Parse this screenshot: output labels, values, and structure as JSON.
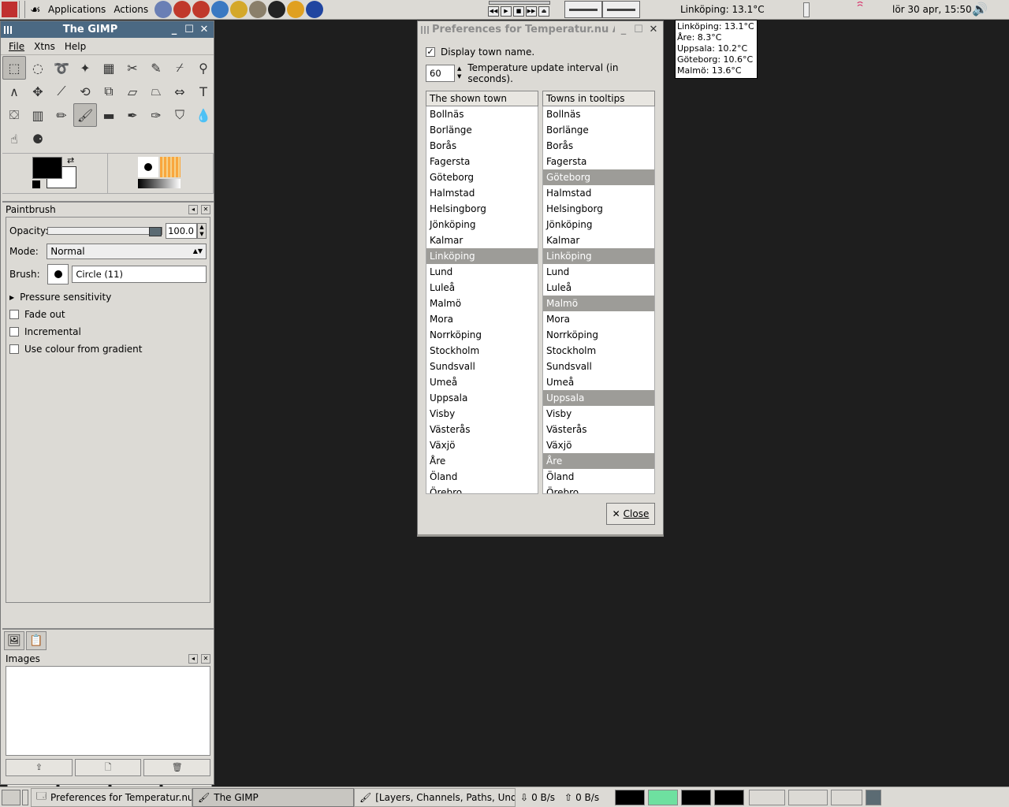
{
  "top_panel": {
    "menus": [
      "Applications",
      "Actions"
    ],
    "launchers": [
      {
        "icon": "image-viewer-icon",
        "color": "#6a7fb5"
      },
      {
        "icon": "alarm-clock-icon",
        "color": "#c0392b"
      },
      {
        "icon": "alarm-clock-icon",
        "color": "#c0392b"
      },
      {
        "icon": "web-browser-icon",
        "color": "#3a79c2"
      },
      {
        "icon": "compass-icon",
        "color": "#d4a82a"
      },
      {
        "icon": "gimp-icon",
        "color": "#8a7f6a"
      },
      {
        "icon": "football-icon",
        "color": "#222222"
      },
      {
        "icon": "person-icon",
        "color": "#e0a020"
      },
      {
        "icon": "bird-icon",
        "color": "#2045a0"
      }
    ],
    "temperature": "Linköping: 13.1°C",
    "clock": "lör 30 apr, 15:50"
  },
  "tooltip": {
    "lines": [
      "Linköping: 13.1°C",
      "Åre: 8.3°C",
      "Uppsala: 10.2°C",
      "Göteborg: 10.6°C",
      "Malmö: 13.6°C"
    ]
  },
  "gimp": {
    "title": "The GIMP",
    "menu": [
      "File",
      "Xtns",
      "Help"
    ],
    "tools": [
      {
        "name": "rect-select-icon",
        "glyph": "⬚",
        "active": true
      },
      {
        "name": "ellipse-select-icon",
        "glyph": "◌"
      },
      {
        "name": "lasso-icon",
        "glyph": "➰"
      },
      {
        "name": "fuzzy-select-icon",
        "glyph": "✦"
      },
      {
        "name": "color-select-icon",
        "glyph": "▦"
      },
      {
        "name": "scissors-icon",
        "glyph": "✂"
      },
      {
        "name": "paths-icon",
        "glyph": "✎"
      },
      {
        "name": "color-picker-icon",
        "glyph": "⌿"
      },
      {
        "name": "zoom-icon",
        "glyph": "⚲"
      },
      {
        "name": "measure-icon",
        "glyph": "∧"
      },
      {
        "name": "move-icon",
        "glyph": "✥"
      },
      {
        "name": "crop-icon",
        "glyph": "⟋"
      },
      {
        "name": "rotate-icon",
        "glyph": "⟲"
      },
      {
        "name": "scale-icon",
        "glyph": "⧉"
      },
      {
        "name": "shear-icon",
        "glyph": "▱"
      },
      {
        "name": "perspective-icon",
        "glyph": "⏢"
      },
      {
        "name": "flip-icon",
        "glyph": "⇔"
      },
      {
        "name": "text-icon",
        "glyph": "T"
      },
      {
        "name": "bucket-fill-icon",
        "glyph": "⛋"
      },
      {
        "name": "gradient-icon",
        "glyph": "▥"
      },
      {
        "name": "pencil-icon",
        "glyph": "✏"
      },
      {
        "name": "paintbrush-icon",
        "glyph": "🖌",
        "active": true
      },
      {
        "name": "eraser-icon",
        "glyph": "▬"
      },
      {
        "name": "airbrush-icon",
        "glyph": "✒"
      },
      {
        "name": "ink-icon",
        "glyph": "✑"
      },
      {
        "name": "clone-icon",
        "glyph": "⛉"
      },
      {
        "name": "blur-icon",
        "glyph": "💧"
      },
      {
        "name": "smudge-icon",
        "glyph": "☝"
      },
      {
        "name": "dodge-burn-icon",
        "glyph": "⚈"
      }
    ],
    "tool_options": {
      "title": "Paintbrush",
      "opacity_label": "Opacity:",
      "opacity_value": "100.0",
      "mode_label": "Mode:",
      "mode_value": "Normal",
      "brush_label": "Brush:",
      "brush_value": "Circle (11)",
      "pressure": "Pressure sensitivity",
      "checks": [
        {
          "label": "Fade out",
          "checked": false
        },
        {
          "label": "Incremental",
          "checked": false
        },
        {
          "label": "Use colour from gradient",
          "checked": false
        }
      ]
    },
    "images_dock": {
      "title": "Images"
    }
  },
  "prefs": {
    "title": "Preferences for Temperatur.nu A",
    "display_town": {
      "label": "Display town name.",
      "checked": true
    },
    "interval": {
      "value": "60",
      "label": "Temperature update interval (in seconds)."
    },
    "shown_header": "The shown town",
    "tooltip_header": "Towns in tooltips",
    "towns": [
      "Bollnäs",
      "Borlänge",
      "Borås",
      "Fagersta",
      "Göteborg",
      "Halmstad",
      "Helsingborg",
      "Jönköping",
      "Kalmar",
      "Linköping",
      "Lund",
      "Luleå",
      "Malmö",
      "Mora",
      "Norrköping",
      "Stockholm",
      "Sundsvall",
      "Umeå",
      "Uppsala",
      "Visby",
      "Västerås",
      "Växjö",
      "Åre",
      "Öland",
      "Örebro"
    ],
    "shown_selected": [
      "Linköping"
    ],
    "tooltip_selected": [
      "Göteborg",
      "Linköping",
      "Malmö",
      "Uppsala",
      "Åre"
    ],
    "close_label": "Close"
  },
  "bottom_panel": {
    "tasks": [
      {
        "label": "Preferences for Temperatur.nu A",
        "icon": "window-icon",
        "active": false
      },
      {
        "label": "The GIMP",
        "icon": "gimp-icon",
        "active": true
      },
      {
        "label": "[Layers, Channels, Paths, Undo",
        "icon": "gimp-icon",
        "active": false
      }
    ],
    "net_down": "0 B/s",
    "net_up": "0 B/s",
    "workspaces": 4,
    "active_workspace": 1
  }
}
